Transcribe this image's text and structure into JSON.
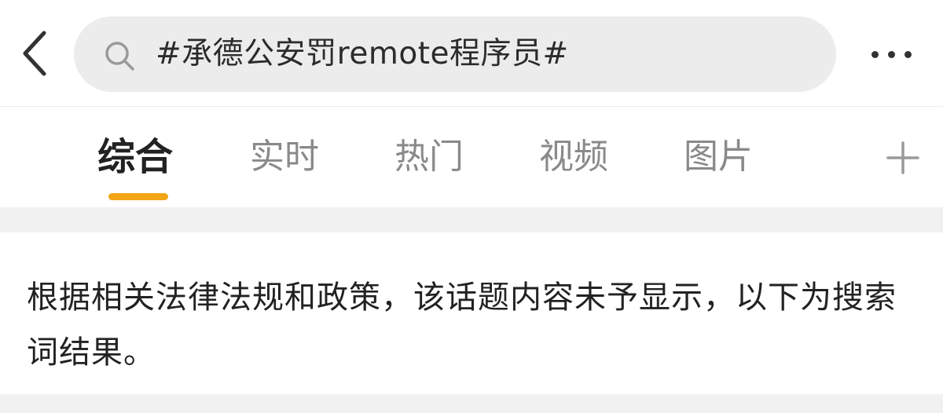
{
  "header": {
    "back_icon": "chevron-left-icon",
    "search": {
      "icon": "search-icon",
      "query": "#承德公安罚remote程序员#"
    },
    "more_icon": "more-dots-icon"
  },
  "tabs": [
    {
      "label": "综合",
      "active": true
    },
    {
      "label": "实时",
      "active": false
    },
    {
      "label": "热门",
      "active": false
    },
    {
      "label": "视频",
      "active": false
    },
    {
      "label": "图片",
      "active": false
    }
  ],
  "tab_add_icon": "plus-icon",
  "notice": {
    "text": "根据相关法律法规和政策，该话题内容未予显示，以下为搜索词结果。"
  },
  "colors": {
    "accent": "#f2a516",
    "search_bg": "#ececec",
    "band_bg": "#f1f1f1",
    "active_tab": "#222222",
    "inactive_tab": "#8a8a8a"
  }
}
